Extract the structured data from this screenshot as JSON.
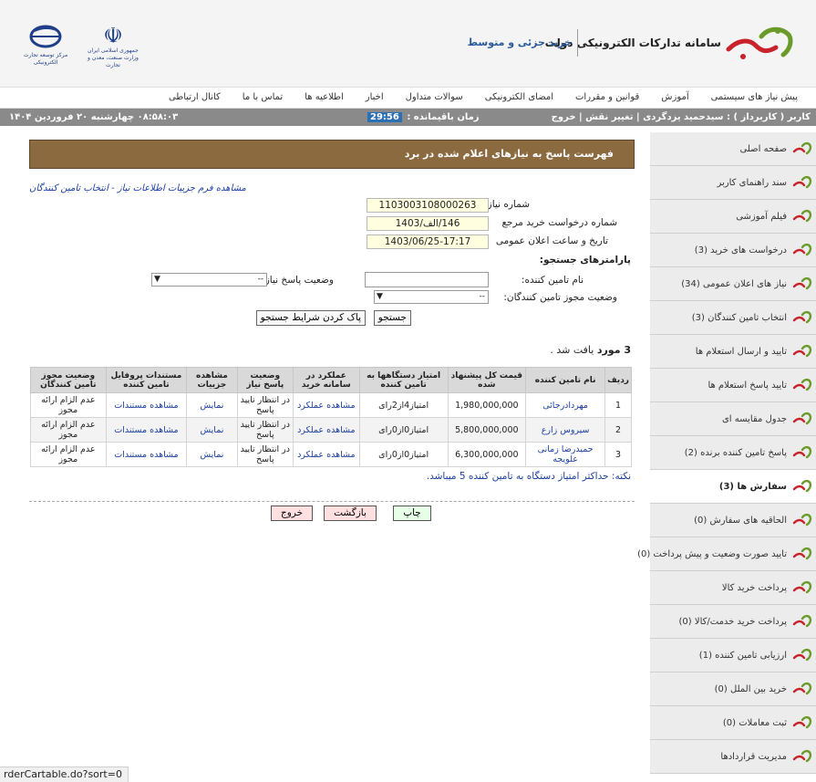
{
  "brand": {
    "title": "سامانه تدارکات الکترونیکی دولت",
    "subtitle": "خرید جزئی و متوسط",
    "gov_logo_text_1": "جمهوری اسلامی ایران",
    "gov_logo_text_2": "وزارت صنعت، معدن و تجارت",
    "org_logo_text": "مرکز توسعه تجارت الکترونیکی"
  },
  "topnav": [
    "پیش نیاز های سیستمی",
    "آموزش",
    "قوانین و مقررات",
    "امضای الکترونیکی",
    "سوالات متداول",
    "اخبار",
    "اطلاعیه ها",
    "تماس با ما",
    "کانال ارتباطی"
  ],
  "userbar": {
    "user_prefix": "کاربر ( کاربرداز ) : سیدحمید یزدگردی |",
    "change_role": "تغییر نقش",
    "separator": "|",
    "logout": "خروج",
    "remaining_label": "زمان باقیمانده :",
    "remaining_time": "29:56",
    "datetime": "۰۸:۵۸:۰۳  چهارشنبه ۲۰ فروردین ۱۴۰۴"
  },
  "sidebar": [
    {
      "label": "صفحه اصلی",
      "active": false
    },
    {
      "label": "سند راهنمای کاربر",
      "active": false
    },
    {
      "label": "فیلم آموزشی",
      "active": false
    },
    {
      "label": "درخواست های خرید (3)",
      "active": false
    },
    {
      "label": "نیاز های اعلان عمومی (34)",
      "active": false
    },
    {
      "label": "انتخاب تامین کنندگان (3)",
      "active": false
    },
    {
      "label": "تایید و ارسال استعلام ها",
      "active": false
    },
    {
      "label": "تایید پاسخ استعلام ها",
      "active": false
    },
    {
      "label": "جدول مقایسه ای",
      "active": false
    },
    {
      "label": "پاسخ تامین کننده برنده (2)",
      "active": false
    },
    {
      "label": "سفارش ها (3)",
      "active": true
    },
    {
      "label": "الحاقیه های سفارش (0)",
      "active": false
    },
    {
      "label": "تایید صورت وضعیت و پیش پرداخت (0)",
      "active": false
    },
    {
      "label": "پرداخت خرید کالا",
      "active": false
    },
    {
      "label": "پرداخت خرید خدمت/کالا (0)",
      "active": false
    },
    {
      "label": "ارزیابی تامین کننده (1)",
      "active": false
    },
    {
      "label": "خرید بین الملل  (0)",
      "active": false
    },
    {
      "label": "ثبت معاملات  (0)",
      "active": false
    },
    {
      "label": "مدیریت قراردادها",
      "active": false
    }
  ],
  "main": {
    "banner": "فهرست پاسخ به نیازهای اعلام شده در برد",
    "detail_link": "مشاهده فرم جزییات اطلاعات نیاز - انتخاب تامین کنندگان",
    "need_number_label": "شماره نیاز",
    "need_number": "1103003108000263",
    "ref_label": "شماره درخواست خرید مرجع",
    "ref_value": "146/الف/1403",
    "date_label": "تاریخ و ساعت اعلان عمومی",
    "date_value": "1403/06/25-17:17",
    "params_title": "پارامترهای جستجو:",
    "supplier_name_label": "نام تامین کننده:",
    "supplier_name_value": "",
    "reply_status_label": "وضعیت پاسخ نیاز:",
    "reply_status_value": "--",
    "license_status_label": "وضعیت مجوز تامین کنندگان:",
    "license_status_value": "--",
    "search_button": "جستجو",
    "clear_button": "پاک کردن شرایط جستجو",
    "found_count": "3 مورد",
    "found_suffix": " یافت شد .",
    "note": "نکته: حداکثر امتیاز دستگاه به تامین کننده 5 میباشد.",
    "print_button": "چاپ",
    "back_button": "بازگشت",
    "exit_button": "خروج"
  },
  "table": {
    "headers": [
      "ردیف",
      "نام تامین کننده",
      "قیمت کل پیشنهاد شده",
      "امتیاز دستگاهها به تامین کننده",
      "عملکرد در سامانه خرید",
      "وضعیت پاسخ نیاز",
      "مشاهده جزییات",
      "مستندات پروفایل تامین کننده",
      "وضعیت مجوز تامین کنندگان"
    ],
    "rows": [
      {
        "idx": "1",
        "supplier": "مهردادرجائی",
        "price": "1,980,000,000",
        "score": "امتیاز4از2رای",
        "perf": "مشاهده عملکرد",
        "status": "در انتظار تایید پاسخ",
        "details": "نمایش",
        "docs": "مشاهده مستندات",
        "license": "عدم الزام ارائه مجوز"
      },
      {
        "idx": "2",
        "supplier": "سیروس زارع",
        "price": "5,800,000,000",
        "score": "امتیاز0از0رای",
        "perf": "مشاهده عملکرد",
        "status": "در انتظار تایید پاسخ",
        "details": "نمایش",
        "docs": "مشاهده مستندات",
        "license": "عدم الزام ارائه مجوز"
      },
      {
        "idx": "3",
        "supplier": "حمیدرضا زمانی علویجه",
        "price": "6,300,000,000",
        "score": "امتیاز0از0رای",
        "perf": "مشاهده عملکرد",
        "status": "در انتظار تایید پاسخ",
        "details": "نمایش",
        "docs": "مشاهده مستندات",
        "license": "عدم الزام ارائه مجوز"
      }
    ]
  },
  "status_url": "rderCartable.do?sort=0",
  "colors": {
    "banner": "#8a6a3e",
    "userbar": "#8a8a8a",
    "link": "#1a3fa0",
    "setad_green": "#6a9b2a",
    "setad_red": "#c8222a"
  }
}
